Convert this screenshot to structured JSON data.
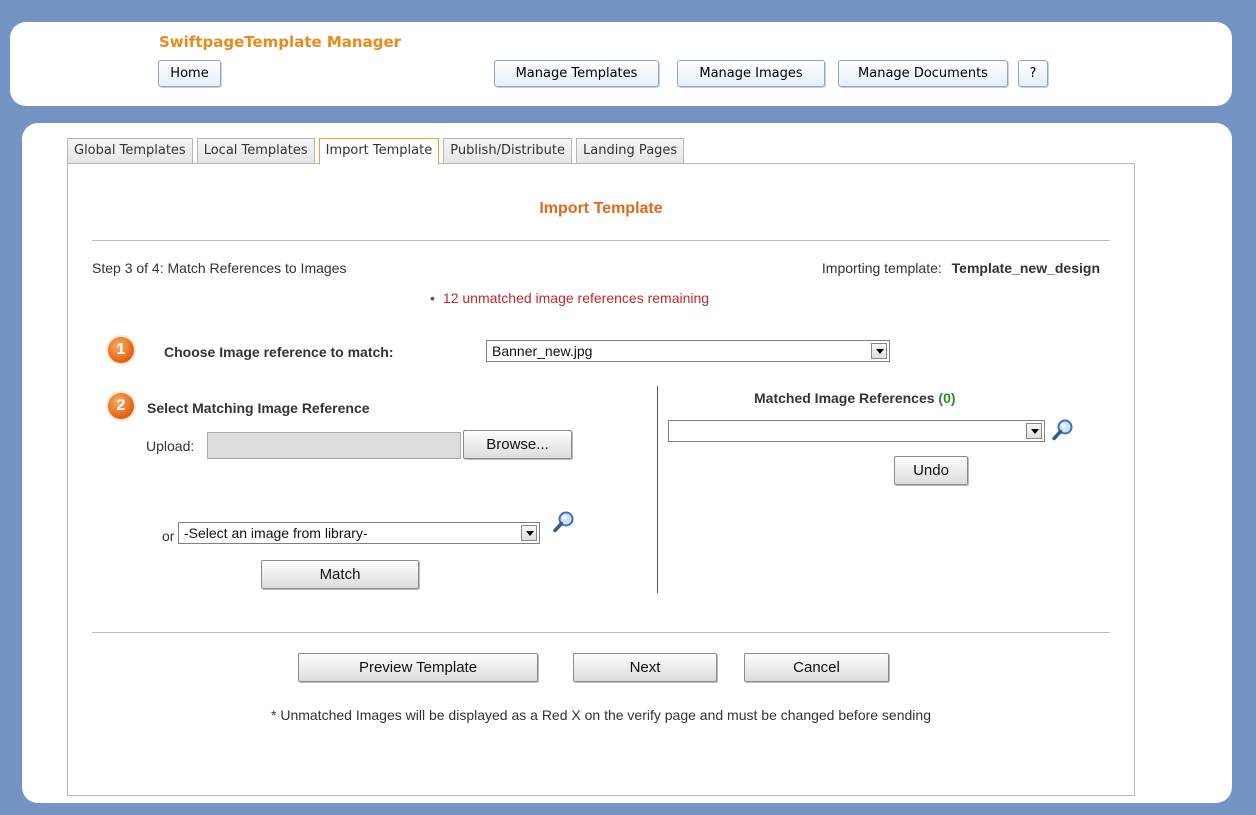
{
  "app": {
    "title": "SwiftpageTemplate Manager"
  },
  "nav": {
    "home": "Home",
    "manage_templates": "Manage Templates",
    "manage_images": "Manage Images",
    "manage_documents": "Manage Documents",
    "help": "?"
  },
  "tabs": [
    {
      "label": "Global Templates",
      "active": false
    },
    {
      "label": "Local Templates",
      "active": false
    },
    {
      "label": "Import Template",
      "active": true
    },
    {
      "label": "Publish/Distribute",
      "active": false
    },
    {
      "label": "Landing Pages",
      "active": false
    }
  ],
  "page": {
    "heading": "Import Template",
    "step": "Step 3 of 4: Match References to Images",
    "importing_label": "Importing template:",
    "importing_name": "Template_new_design",
    "warning_bullet": "•",
    "warning": "12 unmatched image references remaining"
  },
  "step1": {
    "number": "1",
    "label": "Choose Image reference to match:",
    "selected": "Banner_new.jpg"
  },
  "step2": {
    "number": "2",
    "label": "Select Matching Image Reference",
    "upload_label": "Upload:",
    "browse": "Browse...",
    "or_label": "or :",
    "library_selected": "-Select an image from library-",
    "match": "Match"
  },
  "matched": {
    "label": "Matched Image References",
    "count": "(0)",
    "selected": "",
    "undo": "Undo"
  },
  "actions": {
    "preview": "Preview Template",
    "next": "Next",
    "cancel": "Cancel"
  },
  "footnote": "* Unmatched Images will be displayed as a Red X on the verify page and must be changed before sending",
  "colors": {
    "background": "#7393c2",
    "title": "#e88a1c",
    "heading": "#e0681e",
    "warning": "#c0282d",
    "count": "#2a8a2a",
    "active_tab_border": "#e8a33b"
  }
}
